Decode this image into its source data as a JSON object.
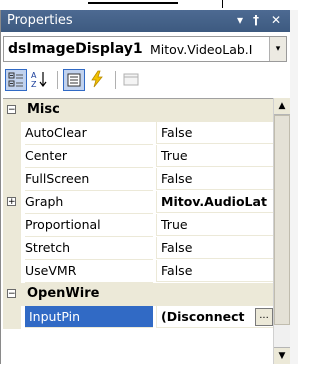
{
  "panel": {
    "title": "Properties",
    "pin_icon": "pin-icon",
    "close_icon": "close-icon",
    "dropdown_glyph": "▾",
    "pin_glyph": "∂",
    "close_glyph": "✕"
  },
  "object_selector": {
    "name": "dsImageDisplay1",
    "type": "Mitov.VideoLab.I",
    "chevron": "▾"
  },
  "toolbar": {
    "buttons": [
      {
        "name": "categorized-icon",
        "checked": true
      },
      {
        "name": "alphabetical-icon",
        "checked": false
      },
      {
        "name": "properties-icon",
        "checked": true
      },
      {
        "name": "events-icon",
        "checked": false
      },
      {
        "name": "property-pages-icon",
        "checked": false
      }
    ]
  },
  "categories": [
    {
      "label": "Misc",
      "expander": "−"
    },
    {
      "label": "OpenWire",
      "expander": "−"
    }
  ],
  "rows": [
    {
      "name": "AutoClear",
      "value": "False"
    },
    {
      "name": "Center",
      "value": "True"
    },
    {
      "name": "FullScreen",
      "value": "False"
    },
    {
      "name": "Graph",
      "value": "Mitov.AudioLat",
      "expander": "+"
    },
    {
      "name": "Proportional",
      "value": "True"
    },
    {
      "name": "Stretch",
      "value": "False"
    },
    {
      "name": "UseVMR",
      "value": "False"
    },
    {
      "name": "InputPin",
      "value": "(Disconnect",
      "ellipsis": "..."
    }
  ],
  "scroll": {
    "up": "▲",
    "down": "▼"
  }
}
